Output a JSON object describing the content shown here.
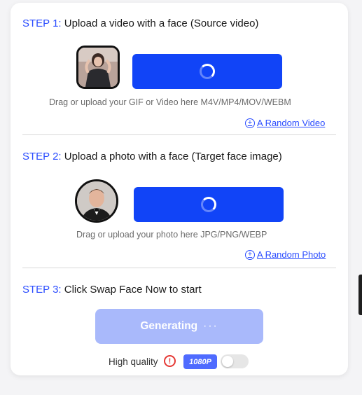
{
  "step1": {
    "num": "STEP 1:",
    "text": "Upload a video with a face (Source video)",
    "hint": "Drag or upload your GIF or Video here M4V/MP4/MOV/WEBM",
    "random_label": "A Random Video"
  },
  "step2": {
    "num": "STEP 2:",
    "text": "Upload a photo with a face (Target face image)",
    "hint": "Drag or upload your photo here JPG/PNG/WEBP",
    "random_label": "A Random Photo"
  },
  "step3": {
    "num": "STEP 3:",
    "text": "Click Swap Face Now to start",
    "generate_label": "Generating",
    "generate_dots": "···"
  },
  "quality": {
    "label": "High quality",
    "warn_glyph": "!",
    "badge": "1080P",
    "toggle_on": false
  },
  "icons": {
    "plus": "+"
  },
  "colors": {
    "accent": "#1144f7",
    "link": "#2b4dff",
    "disabled_button": "#a9b9fb",
    "warning": "#e53935"
  }
}
